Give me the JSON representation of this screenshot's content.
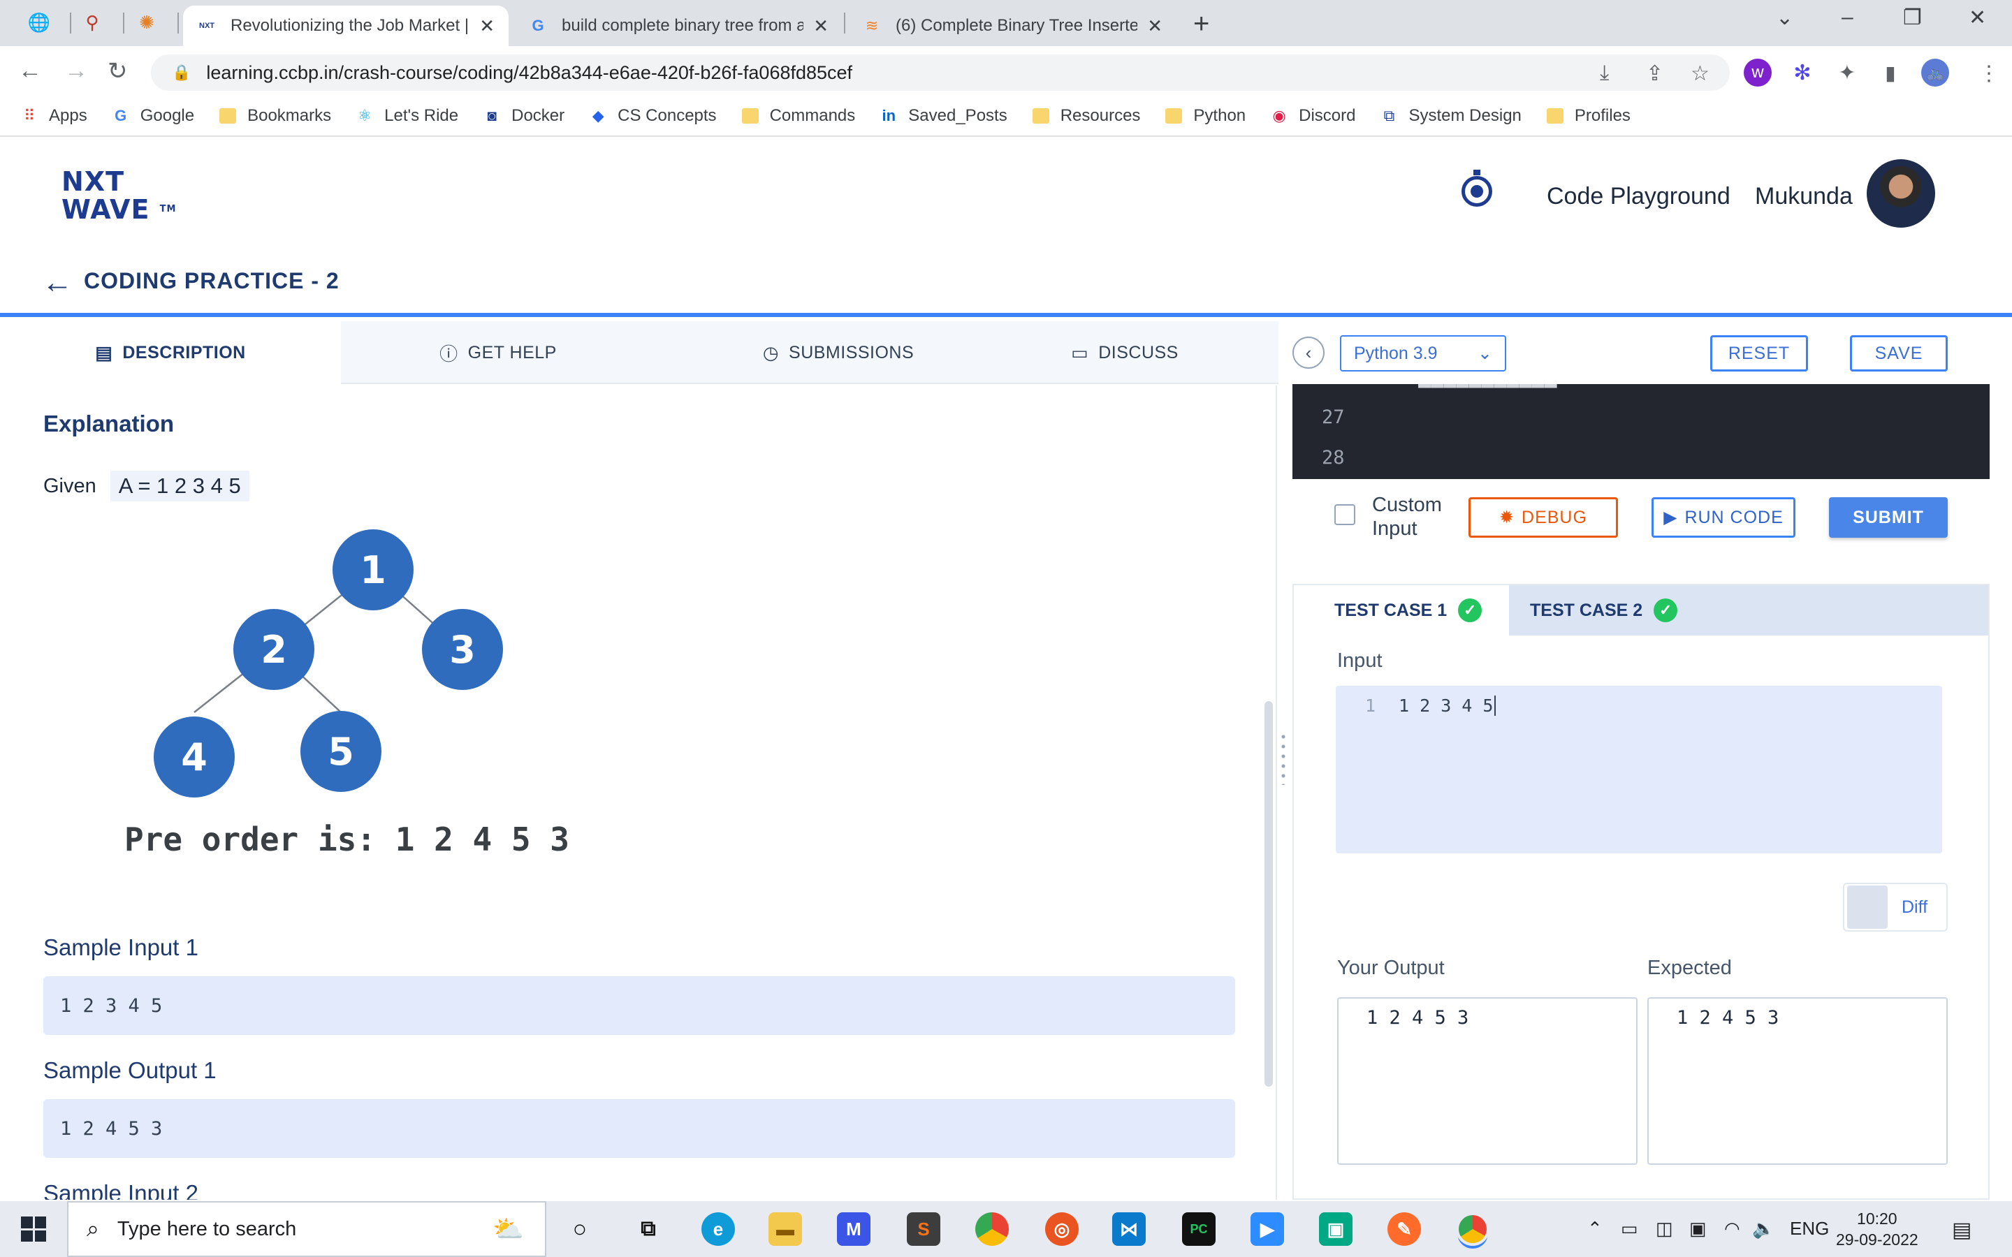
{
  "browser": {
    "tabs": [
      {
        "title": "Revolutionizing the Job Market |"
      },
      {
        "title": "build complete binary tree from a"
      },
      {
        "title": "(6) Complete Binary Tree Inserter"
      }
    ],
    "url": "learning.ccbp.in/crash-course/coding/42b8a344-e6ae-420f-b26f-fa068fd85cef",
    "bookmarks": [
      "Apps",
      "Google",
      "Bookmarks",
      "Let's Ride",
      "Docker",
      "CS Concepts",
      "Commands",
      "Saved_Posts",
      "Resources",
      "Python",
      "Discord",
      "System Design",
      "Profiles"
    ]
  },
  "header": {
    "logo_line1": "NXT",
    "logo_line2": "WAVE",
    "logo_tm": "TM",
    "playground": "Code Playground",
    "user": "Mukunda"
  },
  "practice": {
    "title": "CODING PRACTICE - 2"
  },
  "left_tabs": [
    "DESCRIPTION",
    "GET HELP",
    "SUBMISSIONS",
    "DISCUSS"
  ],
  "description": {
    "heading": "Explanation",
    "given_label": "Given",
    "given_value": "A = 1 2 3 4 5",
    "tree_nodes": [
      "1",
      "2",
      "3",
      "4",
      "5"
    ],
    "preorder_text": "Pre order is: 1 2 4 5 3",
    "sample_input_1_label": "Sample Input 1",
    "sample_input_1": "1 2 3 4 5",
    "sample_output_1_label": "Sample Output 1",
    "sample_output_1": "1 2 4 5 3",
    "sample_input_2_label": "Sample Input 2"
  },
  "editor": {
    "language": "Python 3.9",
    "reset": "RESET",
    "save": "SAVE",
    "line_numbers": [
      "27",
      "28"
    ],
    "custom_input": "Custom Input",
    "debug": "DEBUG",
    "run": "RUN CODE",
    "submit": "SUBMIT"
  },
  "testcases": {
    "tabs": [
      "TEST CASE 1",
      "TEST CASE 2"
    ],
    "input_label": "Input",
    "input_line": "1",
    "input_value": "1 2 3 4 5",
    "diff": "Diff",
    "your_output_label": "Your Output",
    "your_output": "1 2 4 5 3",
    "expected_label": "Expected",
    "expected": "1 2 4 5 3"
  },
  "taskbar": {
    "search_placeholder": "Type here to search",
    "lang": "ENG",
    "time": "10:20",
    "date": "29-09-2022"
  },
  "colors": {
    "brand": "#1e3a6e",
    "accent": "#3b82f6",
    "node": "#2f6cbd",
    "success": "#22c55e",
    "debug": "#ea580c"
  }
}
